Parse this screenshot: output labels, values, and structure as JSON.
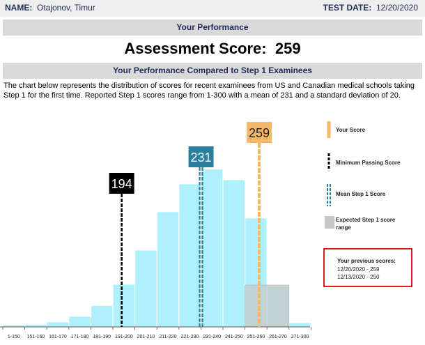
{
  "header": {
    "name_label": "NAME:",
    "name_value": "Otajonov,  Timur",
    "date_label": "TEST DATE:",
    "date_value": "12/20/2020"
  },
  "section_performance": "Your Performance",
  "assessment": {
    "label": "Assessment Score:",
    "value": "259"
  },
  "section_compare": "Your Performance Compared to Step 1 Examinees",
  "description": "The chart below represents the distribution of scores for recent examinees from US and Canadian medical schools taking Step 1 for the first time. Reported Step 1 scores range from 1-300 with a mean of 231 and a standard deviation of 20.",
  "chart_data": {
    "type": "bar",
    "categories": [
      "1-150",
      "151-160",
      "161-170",
      "171-180",
      "181-190",
      "191-200",
      "201-210",
      "211-220",
      "221-230",
      "231-240",
      "241-250",
      "251-260",
      "261-270",
      "271-300"
    ],
    "values": [
      0.5,
      0.6,
      1.2,
      2.5,
      5.0,
      10.0,
      18.0,
      27.0,
      33.5,
      37.0,
      34.5,
      25.5,
      9.5,
      1.0
    ],
    "ylim": [
      0,
      40
    ],
    "markers": [
      {
        "label": "194",
        "value": 194,
        "role": "Minimum Passing Score",
        "color": "#000000"
      },
      {
        "label": "231",
        "value": 231,
        "role": "Mean Step 1 Score",
        "color": "#2a7f9e"
      },
      {
        "label": "259",
        "value": 259,
        "role": "Your Score",
        "color": "#f5b866"
      }
    ],
    "expected_range": [
      250,
      270
    ]
  },
  "legend": {
    "your_score": "Your Score",
    "min_pass": "Minimum Passing Score",
    "mean": "Mean Step 1 Score",
    "expected_l1": "Expected Step 1 score",
    "expected_l2": "range"
  },
  "previous": {
    "title": "Your previous scores:",
    "entries": [
      "12/20/2020 - 259",
      "12/13/2020 - 250"
    ]
  },
  "colors": {
    "bar": "#aef0fb",
    "bar_stroke": "#ffffff",
    "range": "#c8c8c8"
  }
}
